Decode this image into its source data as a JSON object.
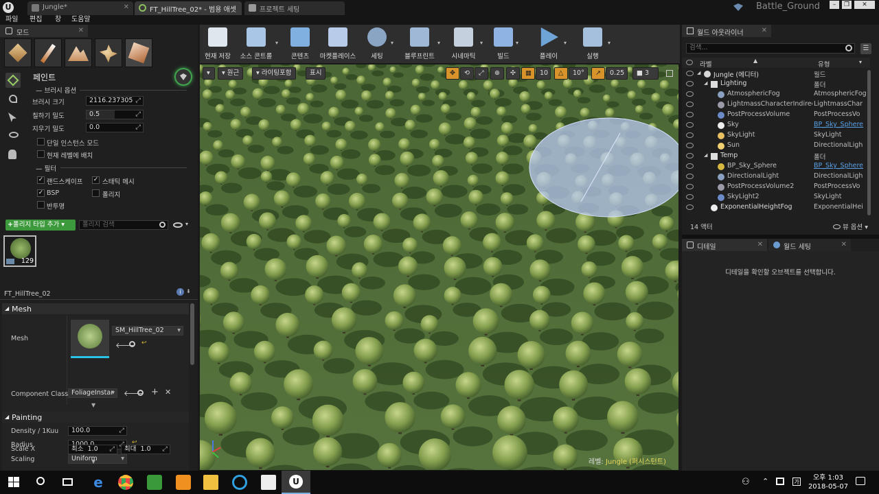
{
  "tabs": [
    {
      "label": "Jungle*",
      "active": false
    },
    {
      "label": "FT_HillTree_02* - 범용 애셋",
      "active": true
    },
    {
      "label": "프로젝트 세팅",
      "active": false
    }
  ],
  "project_name": "Battle_Ground",
  "menu": [
    "파일",
    "편집",
    "창",
    "도움말"
  ],
  "modes": {
    "tab_label": "모드",
    "paint_title": "페인트",
    "brush_options_header": "브러시 옵션",
    "brush_size_label": "브러시 크기",
    "brush_size_value": "2116.237305",
    "paint_density_label": "칠하기 밀도",
    "paint_density_value": "0.5",
    "erase_density_label": "지우기 밀도",
    "erase_density_value": "0.0",
    "single_instance_label": "단일 인스턴스 모드",
    "current_level_label": "현재 레벨에 배치",
    "filter_header": "필터",
    "filters": [
      {
        "label": "랜드스케이프",
        "checked": true
      },
      {
        "label": "스태틱 메시",
        "checked": true
      },
      {
        "label": "BSP",
        "checked": true
      },
      {
        "label": "폴리지",
        "checked": false
      },
      {
        "label": "반투명",
        "checked": false
      }
    ],
    "add_foliage_button": "폴리지 타입 추가",
    "foliage_search_placeholder": "폴리지 검색",
    "thumbnail_count": "129",
    "foliage_name": "FT_HillTree_02",
    "mesh_section": "Mesh",
    "mesh_label": "Mesh",
    "mesh_value": "SM_HillTree_02",
    "component_class_label": "Component Class",
    "component_class_value": "FoliageInstar",
    "painting_section": "Painting",
    "density_label": "Density / 1Kuu",
    "density_value": "100.0",
    "radius_label": "Radius",
    "radius_value": "1000.0",
    "scaling_label": "Scaling",
    "scaling_value": "Uniform",
    "scale_x_label": "Scale X",
    "scale_min_label": "최소",
    "scale_min_value": "1.0",
    "scale_max_label": "최대",
    "scale_max_value": "1.0"
  },
  "toolbar": [
    {
      "label": "현재 저장",
      "color": "#dfe6ee",
      "dropdown": false
    },
    {
      "label": "소스 콘트롤",
      "color": "#a9c6e6",
      "dropdown": true
    },
    {
      "label": "콘텐츠",
      "color": "#7fb0e0",
      "dropdown": false
    },
    {
      "label": "마켓플레이스",
      "color": "#b8cbe8",
      "dropdown": false
    },
    {
      "label": "세팅",
      "color": "#8aa4c4",
      "dropdown": true
    },
    {
      "label": "블루프린트",
      "color": "#9fb8d6",
      "dropdown": true
    },
    {
      "label": "시네마틱",
      "color": "#c4d0de",
      "dropdown": true
    },
    {
      "label": "빌드",
      "color": "#8fb4e4",
      "dropdown": true
    },
    {
      "label": "플레이",
      "color": "#6fa4d6",
      "dropdown": true
    },
    {
      "label": "실행",
      "color": "#a4c0dc",
      "dropdown": true
    }
  ],
  "viewport": {
    "perspective_label": "원근",
    "lighting_label": "라이팅포함",
    "show_label": "표시",
    "grid_snap": "10",
    "rot_snap": "10°",
    "scale_snap": "0.25",
    "camera_speed": "3",
    "level_prefix": "레벨:",
    "level_name": "Jungle (퍼시스턴트)"
  },
  "outliner": {
    "tab_label": "월드 아웃라이너",
    "search_placeholder": "검색...",
    "col_label": "라벨",
    "col_type": "유형",
    "rows": [
      {
        "name": "Jungle (에디터)",
        "type": "월드",
        "indent": 0,
        "link": false
      },
      {
        "name": "Lighting",
        "type": "폴더",
        "indent": 1,
        "link": false
      },
      {
        "name": "AtmosphericFog",
        "type": "AtmosphericFog",
        "indent": 2,
        "link": false
      },
      {
        "name": "LightmassCharacterIndirect",
        "type": "LightmassChar",
        "indent": 2,
        "link": false
      },
      {
        "name": "PostProcessVolume",
        "type": "PostProcessVo",
        "indent": 2,
        "link": false
      },
      {
        "name": "Sky",
        "type": "BP_Sky_Sphere",
        "indent": 2,
        "link": true
      },
      {
        "name": "SkyLight",
        "type": "SkyLight",
        "indent": 2,
        "link": false
      },
      {
        "name": "Sun",
        "type": "DirectionalLigh",
        "indent": 2,
        "link": false
      },
      {
        "name": "Temp",
        "type": "폴더",
        "indent": 1,
        "link": false
      },
      {
        "name": "BP_Sky_Sphere",
        "type": "BP_Sky_Sphere",
        "indent": 2,
        "link": true
      },
      {
        "name": "DirectionalLight",
        "type": "DirectionalLigh",
        "indent": 2,
        "link": false
      },
      {
        "name": "PostProcessVolume2",
        "type": "PostProcessVo",
        "indent": 2,
        "link": false
      },
      {
        "name": "SkyLight2",
        "type": "SkyLight",
        "indent": 2,
        "link": false
      },
      {
        "name": "ExponentialHeightFog",
        "type": "ExponentialHei",
        "indent": 1,
        "link": false
      }
    ],
    "actor_count": "14 액터",
    "view_options": "뷰 옵션"
  },
  "details": {
    "tab_label": "디테일",
    "world_settings_tab": "월드 세팅",
    "empty_message": "디테일을 확인할 오브젝트를 선택합니다."
  },
  "taskbar": {
    "time": "오후 1:03",
    "date": "2018-05-07"
  }
}
